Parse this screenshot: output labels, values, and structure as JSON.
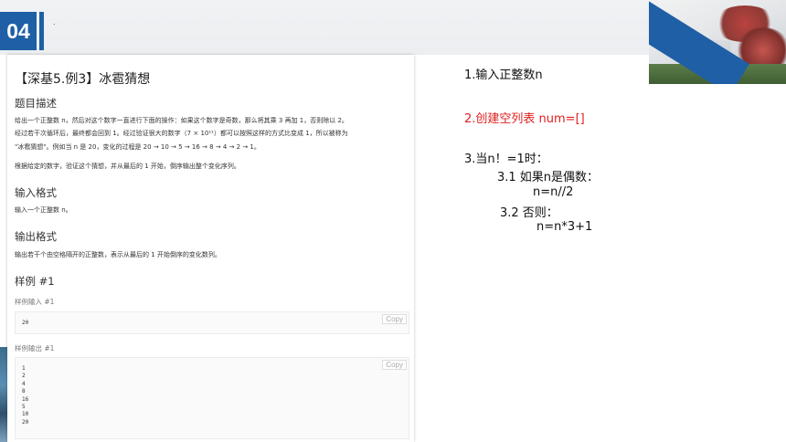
{
  "header": {
    "section_number": "04",
    "mark": "."
  },
  "problem": {
    "title": "【深基5.例3】冰雹猜想",
    "desc_heading": "题目描述",
    "desc_line1": "给出一个正整数 n，然后对这个数字一直进行下面的操作：如果这个数字是奇数，那么将其乘 3 再加 1，否则除以 2。",
    "desc_line2": "经过若干次循环后，最终都会回到 1。经过验证很大的数字（7 × 10¹¹）都可以按照这样的方式比变成 1，所以被称为",
    "desc_line3": "\"冰雹猜想\"。例如当 n 是 20，变化的过程是 20 → 10 → 5 → 16 → 8 → 4 → 2 → 1。",
    "desc_line4": "根据给定的数字，验证这个猜想，并从最后的 1 开始，倒序输出整个变化序列。",
    "input_heading": "输入格式",
    "input_text": "输入一个正整数 n。",
    "output_heading": "输出格式",
    "output_text": "输出若干个由空格隔开的正整数，表示从最后的 1 开始倒序的变化数列。",
    "sample_heading": "样例 #1",
    "sample_input_label": "样例输入 #1",
    "sample_input_value": "20",
    "sample_output_label": "样例输出 #1",
    "sample_output_lines": [
      "1",
      "2",
      "4",
      "8",
      "16",
      "5",
      "10",
      "20"
    ],
    "copy_label": "Copy"
  },
  "steps": {
    "s1": "1.输入正整数n",
    "s2": "2.创建空列表  num=[]",
    "s3": "3.当n！=1时：",
    "s3_1": "3.1   如果n是偶数：",
    "s3_1_code": "n=n//2",
    "s3_2": "3.2    否则：",
    "s3_2_code": "n=n*3+1"
  },
  "colors": {
    "accent": "#1f5fa5",
    "highlight": "#e02020"
  }
}
